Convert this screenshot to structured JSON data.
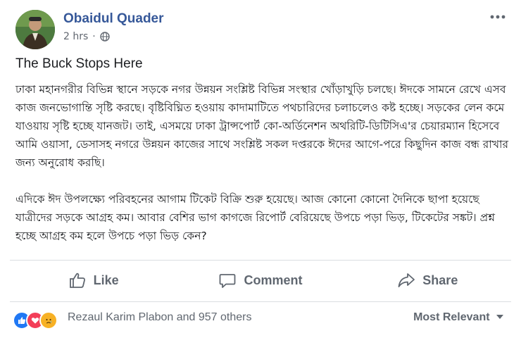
{
  "post": {
    "author": "Obaidul Quader",
    "time": "2 hrs",
    "separator": "·",
    "privacy_icon": "globe-icon",
    "more_icon": "more-options-icon",
    "title": "The Buck Stops Here",
    "paragraphs": [
      "ঢাকা মহানগরীর বিভিন্ন স্থানে সড়কে নগর উন্নয়ন সংশ্লিষ্ট বিভিন্ন সংস্থার খোঁড়াখুড়ি চলছে। ঈদকে সামনে রেখে এসব কাজ জনভোগান্তি সৃষ্টি করছে। বৃষ্টিবিঘ্নিত হওয়ায় কাদামাটিতে পথচারিদের চলাচলেও কষ্ট হচ্ছে। সড়কের লেন কমে যাওয়ায় সৃষ্টি হচ্ছে যানজট। তাই, এসময়ে ঢাকা ট্রান্সপোর্ট কো-অর্ডিনেশন অথরিটি-ডিটিসিএ'র চেয়ারম্যান হিসেবে আমি ওয়াসা, ডেসাসহ নগরে উন্নয়ন কাজের সাথে সংশ্লিষ্ট সকল দপ্তরকে ঈদের আগে-পরে কিছুদিন কাজ বন্ধ রাখার জন্য অনুরোধ করছি।",
      "এদিকে ঈদ উপলক্ষ্যে পরিবহনের আগাম টিকেট বিক্রি শুরু হয়েছে। আজ কোনো কোনো দৈনিকে ছাপা হয়েছে যাত্রীদের সড়কে আগ্রহ কম। আবার বেশির ভাগ কাগজে রিপোর্ট বেরিয়েছে উপচে পড়া ভিড়, টিকেটের সঙ্কট। প্রশ্ন হচ্ছে আগ্রহ কম হলে উপচে পড়া ভিড় কেন?"
    ]
  },
  "actions": [
    {
      "label": "Like",
      "icon": "thumbs-up-icon"
    },
    {
      "label": "Comment",
      "icon": "comment-icon"
    },
    {
      "label": "Share",
      "icon": "share-icon"
    }
  ],
  "reactions": {
    "icons": [
      "like-reaction-icon",
      "love-reaction-icon",
      "sad-reaction-icon"
    ],
    "summary": "Rezaul Karim Plabon and 957 others",
    "sort_label": "Most Relevant",
    "sort_icon": "caret-down-icon"
  },
  "colors": {
    "author_link": "#365899",
    "muted_text": "#606770",
    "like_blue": "#2078f4",
    "love_red": "#f33e58",
    "sad_yellow": "#f7b125"
  }
}
